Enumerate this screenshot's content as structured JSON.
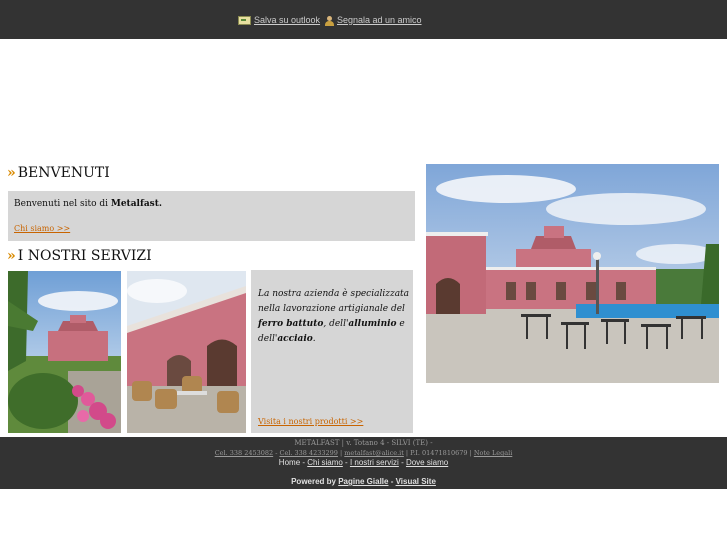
{
  "topbar": {
    "save_outlook": "Salva su outlook",
    "recommend": "Segnala ad un amico"
  },
  "welcome": {
    "title": "BENVENUTI",
    "text_prefix": "Benvenuti nel sito di ",
    "brand": "Metalfast.",
    "link": "Chi siamo >>"
  },
  "services": {
    "title": "I NOSTRI SERVIZI",
    "text_1": "La nostra azienda è specializzata nella lavorazione artigianale del ",
    "bold_1": "ferro battuto",
    "text_2": ", dell'",
    "bold_2": "alluminio",
    "text_3": " e dell'",
    "bold_3": "acciaio",
    "text_4": ".",
    "link": "Visita i nostri prodotti >>"
  },
  "footer": {
    "address": "METALFAST | v. Totano 4 - SILVI (TE) -",
    "cell_1": "Cel. 338 2453082",
    "sep_1": " - ",
    "cell_2": "Cel. 338 4233299",
    "sep_2": " | ",
    "email": "metalfast@alice.it",
    "vat": " | P.I. 01471810679 | ",
    "legal": "Note Legali",
    "nav_home": "Home",
    "nav_sep": " - ",
    "nav_chi": "Chi siamo",
    "nav_servizi": "I nostri servizi",
    "nav_dove": "Dove siamo",
    "powered_prefix": "Powered by ",
    "powered_pg": "Pagine Gialle",
    "powered_sep": " - ",
    "powered_vs": "Visual Site"
  },
  "icons": {
    "outlook": "outlook-card-icon",
    "recommend": "friend-icon",
    "arrow": "double-chevron-icon"
  },
  "colors": {
    "bar": "#333333",
    "box": "#d6d6d6",
    "link": "#c86400",
    "accent": "#d98a00"
  }
}
